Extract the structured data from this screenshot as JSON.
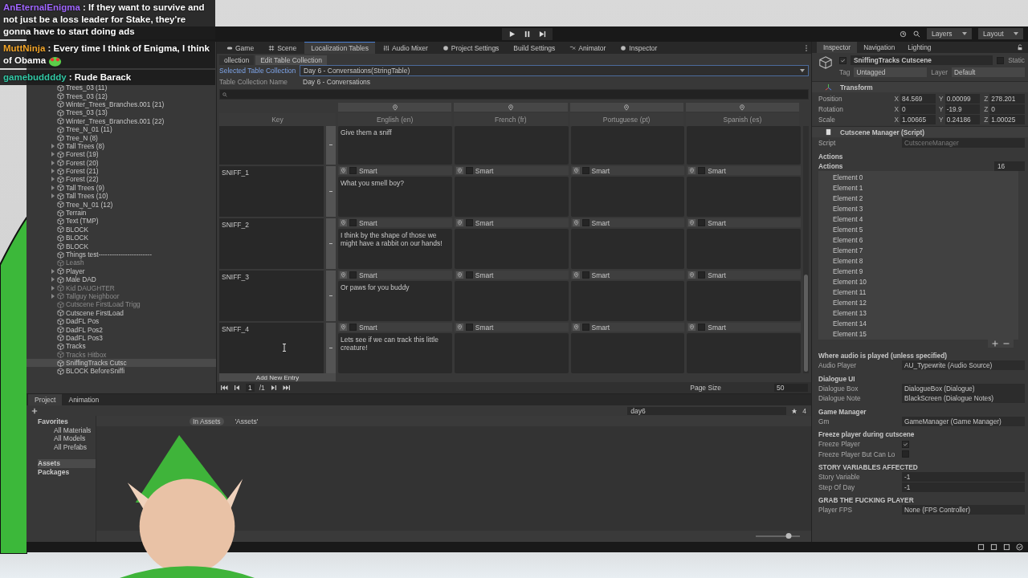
{
  "chat": [
    {
      "user": "AnEternalEnigma",
      "color": "#a066ff",
      "separator": ":",
      "message": "If they want to survive and not just be a loss leader for Stake, they're gonna have to start doing ads",
      "emote": false
    },
    {
      "user": "MuttNinja",
      "color": "#f2a52a",
      "separator": ":",
      "message": "Every time I think of Enigma, I think of Obama",
      "emote": true
    },
    {
      "user": "gamebuddddy",
      "color": "#33c9a6",
      "separator": ":",
      "message": "Rude Barack",
      "emote": false
    }
  ],
  "toolbar": {
    "layers": "Layers",
    "layout": "Layout"
  },
  "hierarchy": {
    "items": [
      {
        "name": "Trees_03 (11)",
        "has_children": false,
        "disabled": false,
        "selected": false
      },
      {
        "name": "Trees_03 (12)",
        "has_children": false,
        "disabled": false,
        "selected": false
      },
      {
        "name": "Winter_Trees_Branches.001 (21)",
        "has_children": false,
        "disabled": false,
        "selected": false
      },
      {
        "name": "Trees_03 (13)",
        "has_children": false,
        "disabled": false,
        "selected": false
      },
      {
        "name": "Winter_Trees_Branches.001 (22)",
        "has_children": false,
        "disabled": false,
        "selected": false
      },
      {
        "name": "Tree_N_01 (11)",
        "has_children": false,
        "disabled": false,
        "selected": false
      },
      {
        "name": "Tree_N (8)",
        "has_children": false,
        "disabled": false,
        "selected": false
      },
      {
        "name": "Tall Trees (8)",
        "has_children": true,
        "disabled": false,
        "selected": false
      },
      {
        "name": "Forest (19)",
        "has_children": true,
        "disabled": false,
        "selected": false
      },
      {
        "name": "Forest (20)",
        "has_children": true,
        "disabled": false,
        "selected": false
      },
      {
        "name": "Forest (21)",
        "has_children": true,
        "disabled": false,
        "selected": false
      },
      {
        "name": "Forest (22)",
        "has_children": true,
        "disabled": false,
        "selected": false
      },
      {
        "name": "Tall Trees (9)",
        "has_children": true,
        "disabled": false,
        "selected": false
      },
      {
        "name": "Tall Trees (10)",
        "has_children": true,
        "disabled": false,
        "selected": false
      },
      {
        "name": "Tree_N_01 (12)",
        "has_children": false,
        "disabled": false,
        "selected": false
      },
      {
        "name": "Terrain",
        "has_children": false,
        "disabled": false,
        "selected": false
      },
      {
        "name": "Text (TMP)",
        "has_children": false,
        "disabled": false,
        "selected": false
      },
      {
        "name": "BLOCK",
        "has_children": false,
        "disabled": false,
        "selected": false
      },
      {
        "name": "BLOCK",
        "has_children": false,
        "disabled": false,
        "selected": false
      },
      {
        "name": "BLOCK",
        "has_children": false,
        "disabled": false,
        "selected": false
      },
      {
        "name": "Things test------------------------",
        "has_children": false,
        "disabled": false,
        "selected": false
      },
      {
        "name": "Leash",
        "has_children": false,
        "disabled": true,
        "selected": false
      },
      {
        "name": "Player",
        "has_children": true,
        "disabled": false,
        "selected": false
      },
      {
        "name": "Male DAD",
        "has_children": true,
        "disabled": false,
        "selected": false
      },
      {
        "name": "Kid DAUGHTER",
        "has_children": true,
        "disabled": true,
        "selected": false
      },
      {
        "name": "Tallguy Neighboor",
        "has_children": true,
        "disabled": true,
        "selected": false
      },
      {
        "name": "Cutscene FirstLoad Trigg",
        "has_children": false,
        "disabled": true,
        "selected": false
      },
      {
        "name": "Cutscene FirstLoad",
        "has_children": false,
        "disabled": false,
        "selected": false
      },
      {
        "name": "DadFL Pos",
        "has_children": false,
        "disabled": false,
        "selected": false
      },
      {
        "name": "DadFL Pos2",
        "has_children": false,
        "disabled": false,
        "selected": false
      },
      {
        "name": "DadFL Pos3",
        "has_children": false,
        "disabled": false,
        "selected": false
      },
      {
        "name": "Tracks",
        "has_children": false,
        "disabled": false,
        "selected": false
      },
      {
        "name": "Tracks Hitbox",
        "has_children": false,
        "disabled": true,
        "selected": false
      },
      {
        "name": "SniffingTracks Cutsc",
        "has_children": false,
        "disabled": false,
        "selected": true
      },
      {
        "name": "BLOCK BeforeSniffi",
        "has_children": false,
        "disabled": false,
        "selected": false
      }
    ]
  },
  "localization": {
    "tabs": [
      {
        "label": "Game",
        "selected": false
      },
      {
        "label": "Scene",
        "selected": false
      },
      {
        "label": "Localization Tables",
        "selected": true
      },
      {
        "label": "Audio Mixer",
        "selected": false
      },
      {
        "label": "Project Settings",
        "selected": false
      },
      {
        "label": "Build Settings",
        "selected": false
      },
      {
        "label": "Animator",
        "selected": false
      },
      {
        "label": "Inspector",
        "selected": false
      }
    ],
    "subtabs": [
      {
        "label": "ollection",
        "selected": false
      },
      {
        "label": "Edit Table Collection",
        "selected": true
      }
    ],
    "selected_collection": {
      "label": "Selected Table Collection",
      "value": "Day 6 - Conversations(StringTable)"
    },
    "collection_name": {
      "label": "Table Collection Name",
      "value": "Day 6 - Conversations"
    },
    "columns": [
      "Key",
      "English (en)",
      "French (fr)",
      "Portuguese (pt)",
      "Spanish (es)"
    ],
    "rows": [
      {
        "cells": [
          {
            "kind": "key"
          },
          {
            "kind": "translation",
            "text": "Give them a sniff"
          },
          {
            "kind": "translation"
          },
          {
            "kind": "translation"
          },
          {
            "kind": "translation"
          }
        ]
      },
      {
        "cells": [
          {
            "kind": "key",
            "text": "SNIFF_1"
          },
          {
            "smart_label": "Smart",
            "smart": false,
            "text": "What you smell boy?"
          },
          {
            "smart_label": "Smart",
            "smart": false
          },
          {
            "smart_label": "Smart",
            "smart": false
          },
          {
            "smart_label": "Smart",
            "smart": false
          }
        ]
      },
      {
        "cells": [
          {
            "kind": "key",
            "text": "SNIFF_2"
          },
          {
            "smart_label": "Smart",
            "smart": false,
            "text": "I think by the shape of those we might have a rabbit on our hands!"
          },
          {
            "smart_label": "Smart",
            "smart": false
          },
          {
            "smart_label": "Smart",
            "smart": false
          },
          {
            "smart_label": "Smart",
            "smart": false
          }
        ]
      },
      {
        "cells": [
          {
            "kind": "key",
            "text": "SNIFF_3"
          },
          {
            "smart_label": "Smart",
            "smart": false,
            "text": "Or paws for you buddy"
          },
          {
            "smart_label": "Smart",
            "smart": false
          },
          {
            "smart_label": "Smart",
            "smart": false
          },
          {
            "smart_label": "Smart",
            "smart": false
          }
        ]
      },
      {
        "cells": [
          {
            "kind": "key",
            "text": "SNIFF_4"
          },
          {
            "smart_label": "Smart",
            "smart": false,
            "text": "Lets see if we can track this little creature!"
          },
          {
            "smart_label": "Smart",
            "smart": false
          },
          {
            "smart_label": "Smart",
            "smart": false
          },
          {
            "smart_label": "Smart",
            "smart": false
          }
        ]
      }
    ],
    "add_button": "Add New Entry",
    "pager": {
      "page": "1",
      "total": "/1",
      "page_size_label": "Page Size",
      "page_size": "50"
    }
  },
  "project": {
    "tabs": [
      {
        "label": "Project",
        "selected": true
      },
      {
        "label": "Animation",
        "selected": false
      }
    ],
    "search": "day6",
    "hidden_count": "4",
    "favorites": {
      "name": "Favorites",
      "children": [
        {
          "name": "All Materials",
          "selected": false
        },
        {
          "name": "All Models",
          "selected": false
        },
        {
          "name": "All Prefabs",
          "selected": false
        }
      ]
    },
    "folders": [
      {
        "name": "Assets",
        "selected": true
      },
      {
        "name": "Packages",
        "selected": false
      }
    ],
    "breadcrumbs": [
      {
        "label": "In Assets",
        "selected": true
      },
      {
        "label": "'Assets'",
        "selected": false
      }
    ],
    "zoom": {
      "level": 0.75
    }
  },
  "inspector": {
    "tabs": [
      {
        "label": "Inspector",
        "selected": true
      },
      {
        "label": "Navigation",
        "selected": false
      },
      {
        "label": "Lighting",
        "selected": false
      }
    ],
    "object": {
      "active": true,
      "name": "SniffingTracks Cutscene",
      "static": false,
      "static_label": "Static",
      "tag_label": "Tag",
      "tag": "Untagged",
      "layer_label": "Layer",
      "layer": "Default"
    },
    "transform": {
      "title": "Transform",
      "rows": [
        {
          "label": "Position",
          "values": [
            {
              "axis": "X",
              "value": "84.569"
            },
            {
              "axis": "Y",
              "value": "0.00099"
            },
            {
              "axis": "Z",
              "value": "278.201"
            }
          ]
        },
        {
          "label": "Rotation",
          "values": [
            {
              "axis": "X",
              "value": "0"
            },
            {
              "axis": "Y",
              "value": "-19.9"
            },
            {
              "axis": "Z",
              "value": "0"
            }
          ]
        },
        {
          "label": "Scale",
          "values": [
            {
              "axis": "X",
              "value": "1.00665"
            },
            {
              "axis": "Y",
              "value": "0.24186"
            },
            {
              "axis": "Z",
              "value": "1.00025"
            }
          ]
        }
      ]
    },
    "script": {
      "title": "Cutscene Manager (Script)",
      "script_label": "Script",
      "script_value": "CutsceneManager",
      "actions_header": "Actions",
      "actions_label": "Actions",
      "actions_count": "16",
      "elements": [
        "Element 0",
        "Element 1",
        "Element 2",
        "Element 3",
        "Element 4",
        "Element 5",
        "Element 6",
        "Element 7",
        "Element 8",
        "Element 9",
        "Element 10",
        "Element 11",
        "Element 12",
        "Element 13",
        "Element 14",
        "Element 15"
      ],
      "sections": [
        {
          "title": "Where audio is played (unless specified)",
          "fields": [
            {
              "kind": "object",
              "label": "Audio Player",
              "value": "AU_Typewrite (Audio Source)"
            }
          ]
        },
        {
          "title": "Dialogue UI",
          "fields": [
            {
              "kind": "object",
              "label": "Dialogue Box",
              "value": "DialogueBox (Dialogue)"
            },
            {
              "kind": "object",
              "label": "Dialogue Note",
              "value": "BlackScreen (Dialogue Notes)"
            }
          ]
        },
        {
          "title": "Game Manager",
          "fields": [
            {
              "kind": "object",
              "label": "Gm",
              "value": "GameManager (Game Manager)"
            }
          ]
        },
        {
          "title": "Freeze player during cutscene",
          "fields": [
            {
              "kind": "check",
              "label": "Freeze Player",
              "checked": true
            },
            {
              "kind": "check",
              "label": "Freeze Player But Can Lo",
              "checked": false
            }
          ]
        },
        {
          "title": "STORY VARIABLES AFFECTED",
          "fields": [
            {
              "kind": "text",
              "label": "Story Variable",
              "value": "-1"
            },
            {
              "kind": "text",
              "label": "Step Of Day",
              "value": "-1"
            }
          ]
        },
        {
          "title": "GRAB THE FUCKING PLAYER",
          "fields": [
            {
              "kind": "object",
              "label": "Player FPS",
              "value": "None (FPS Controller)"
            }
          ]
        }
      ]
    }
  }
}
